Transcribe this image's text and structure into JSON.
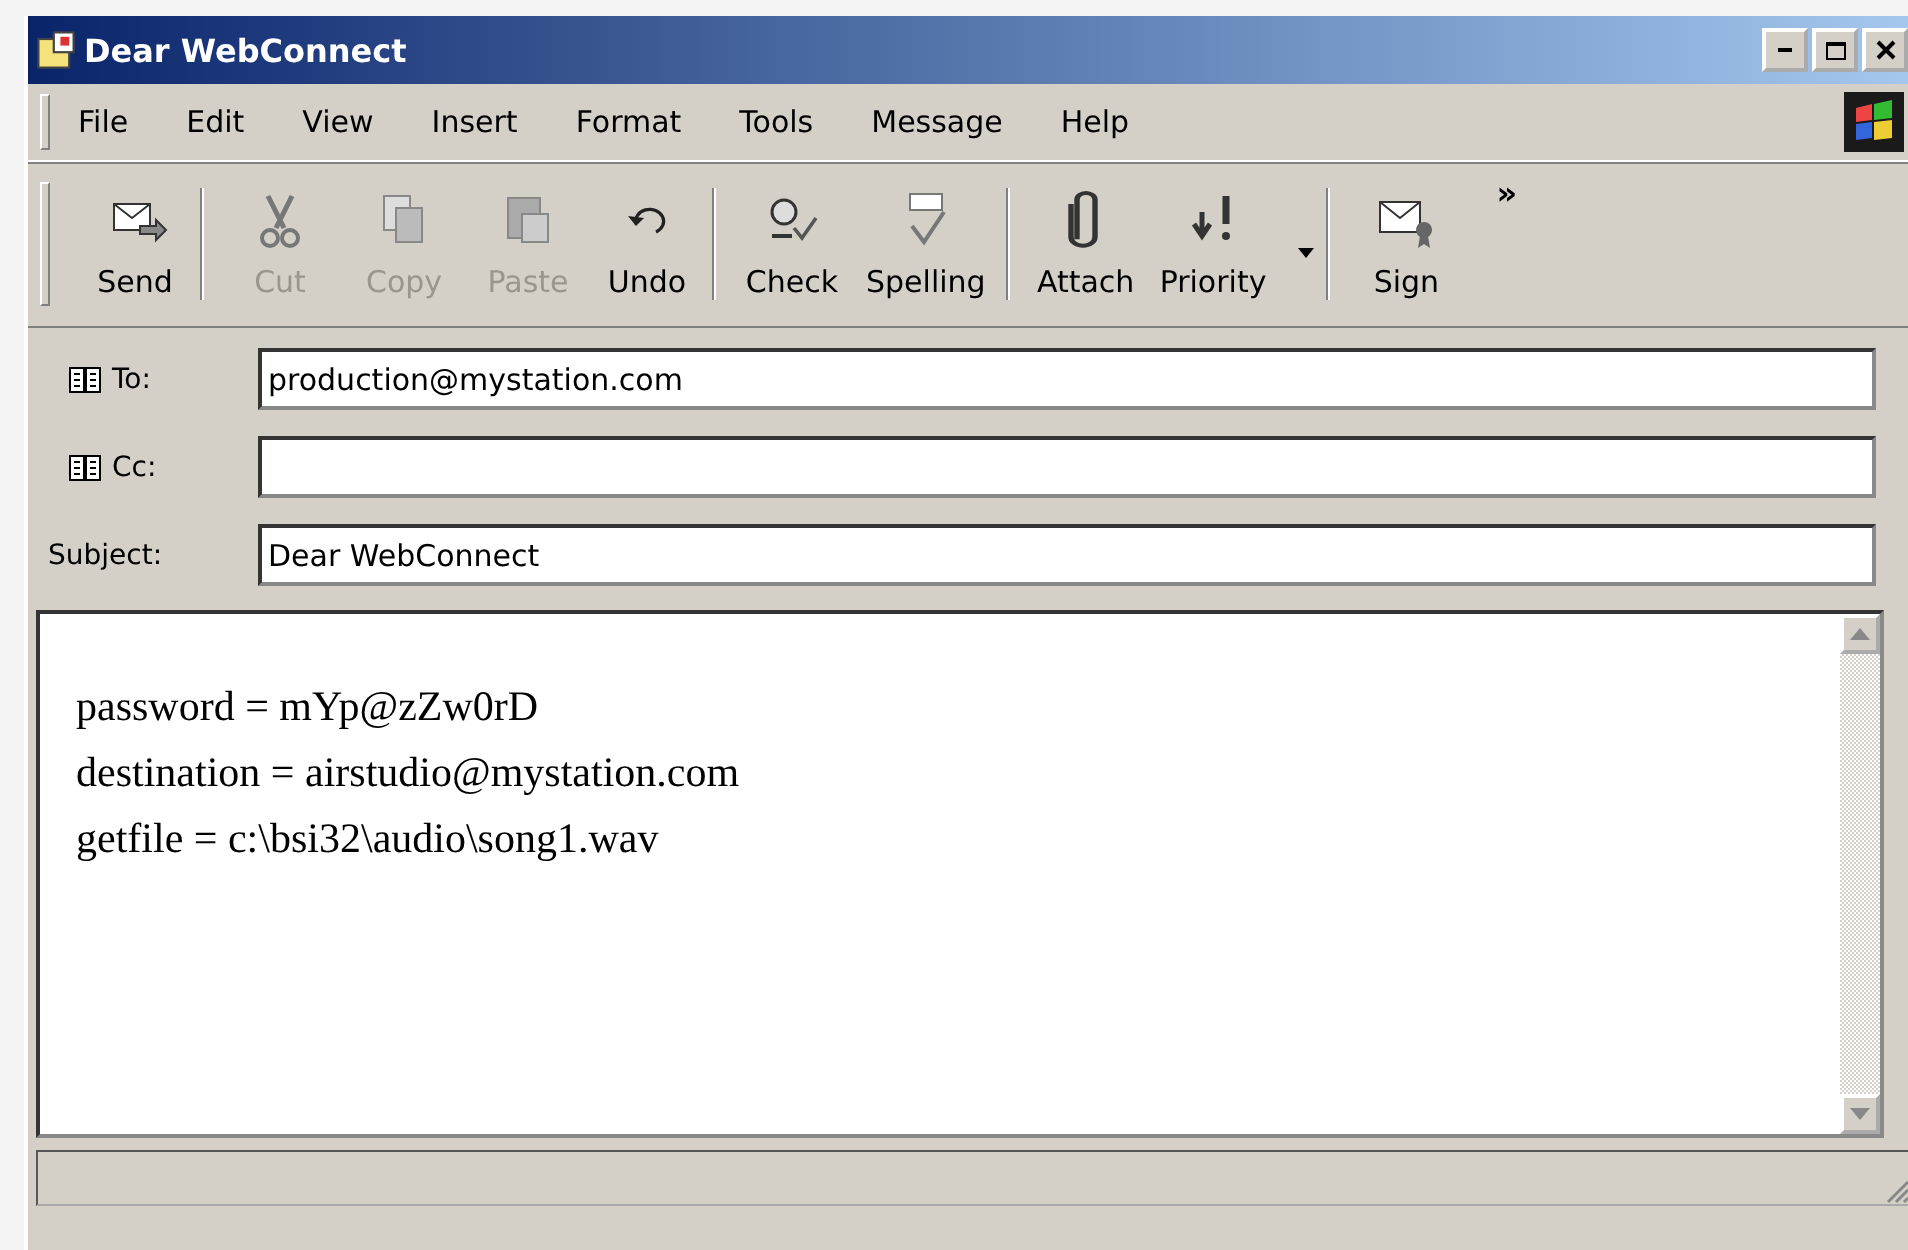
{
  "window": {
    "title": "Dear WebConnect"
  },
  "menu": [
    "File",
    "Edit",
    "View",
    "Insert",
    "Format",
    "Tools",
    "Message",
    "Help"
  ],
  "toolbar": [
    {
      "label": "Send",
      "disabled": false,
      "separator_after": true
    },
    {
      "label": "Cut",
      "disabled": true,
      "separator_after": false
    },
    {
      "label": "Copy",
      "disabled": true,
      "separator_after": false
    },
    {
      "label": "Paste",
      "disabled": true,
      "separator_after": false
    },
    {
      "label": "Undo",
      "disabled": false,
      "separator_after": true
    },
    {
      "label": "Check",
      "disabled": false,
      "separator_after": false
    },
    {
      "label": "Spelling",
      "disabled": false,
      "separator_after": true
    },
    {
      "label": "Attach",
      "disabled": false,
      "separator_after": false
    },
    {
      "label": "Priority",
      "disabled": false,
      "separator_after": true,
      "dropdown": true
    },
    {
      "label": "Sign",
      "disabled": false,
      "separator_after": false
    }
  ],
  "toolbar_overflow": "»",
  "headers": [
    {
      "label": "To:",
      "address_book": true,
      "value": "production@mystation.com"
    },
    {
      "label": "Cc:",
      "address_book": true
    },
    {
      "label": "Subject:",
      "address_book": false,
      "value": "Dear WebConnect"
    }
  ],
  "body": [
    "password = mYp@zZw0rD",
    "destination = airstudio@mystation.com",
    "getfile = c:\\bsi32\\audio\\song1.wav"
  ]
}
